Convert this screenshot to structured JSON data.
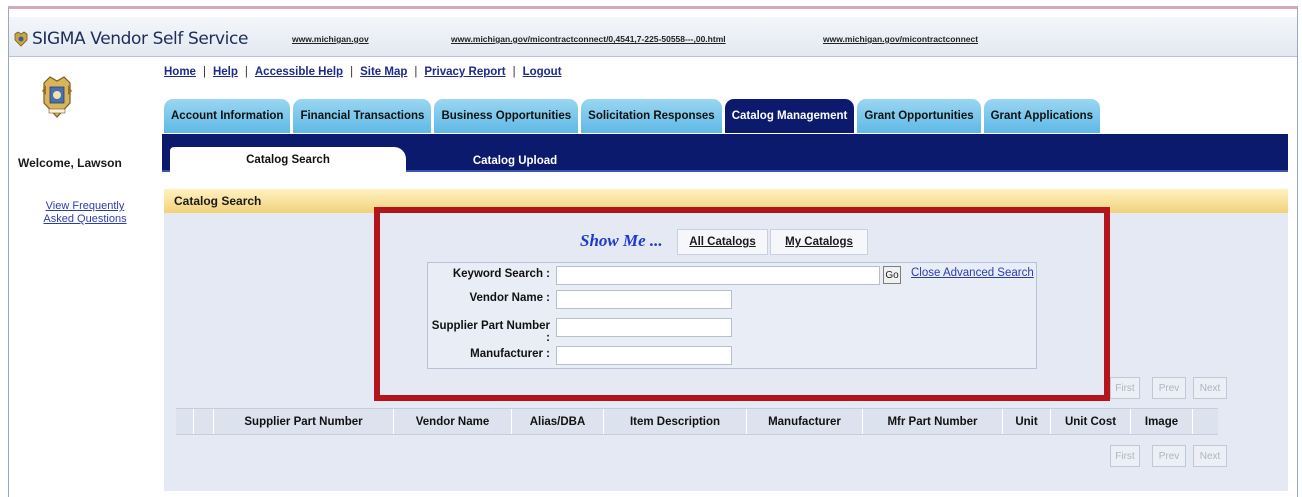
{
  "top_strip": {
    "brand": "SIGMA Vendor Self Service",
    "urls": [
      "www.michigan.gov",
      "www.michigan.gov/micontractconnect/0,4541,7-225-50558---,00.html",
      "www.michigan.gov/micontractconnect"
    ]
  },
  "sidebar": {
    "welcome": "Welcome, Lawson",
    "faq_line1": "View Frequently",
    "faq_line2": "Asked Questions"
  },
  "top_links": [
    "Home",
    "Help",
    "Accessible Help",
    "Site Map",
    "Privacy Report",
    "Logout"
  ],
  "tabs": [
    {
      "label": "Account Information",
      "active": false
    },
    {
      "label": "Financial Transactions",
      "active": false
    },
    {
      "label": "Business Opportunities",
      "active": false
    },
    {
      "label": "Solicitation Responses",
      "active": false
    },
    {
      "label": "Catalog Management",
      "active": true
    },
    {
      "label": "Grant Opportunities",
      "active": false
    },
    {
      "label": "Grant Applications",
      "active": false
    }
  ],
  "subtabs": {
    "active": "Catalog Search",
    "inactive": "Catalog Upload"
  },
  "section_title": "Catalog Search",
  "show_me": {
    "label": "Show Me ...",
    "all_catalogs": "All Catalogs",
    "my_catalogs": "My Catalogs"
  },
  "search_form": {
    "keyword_label": "Keyword Search :",
    "keyword_value": "",
    "vendor_label": "Vendor Name :",
    "vendor_value": "",
    "part_label": "Supplier Part Number :",
    "part_value": "",
    "manufacturer_label": "Manufacturer :",
    "manufacturer_value": "",
    "go_label": "Go",
    "advanced_link": "Close Advanced Search"
  },
  "pagination": {
    "first": "First",
    "prev": "Prev",
    "next": "Next"
  },
  "table": {
    "columns": [
      "Supplier Part Number",
      "Vendor Name",
      "Alias/DBA",
      "Item Description",
      "Manufacturer",
      "Mfr Part Number",
      "Unit",
      "Unit Cost",
      "Image"
    ]
  },
  "colors": {
    "nav_dark": "#0c1a6e",
    "tab_light": "#6ec4ec",
    "highlight_red": "#b4141c",
    "link_blue": "#2a3db0"
  }
}
